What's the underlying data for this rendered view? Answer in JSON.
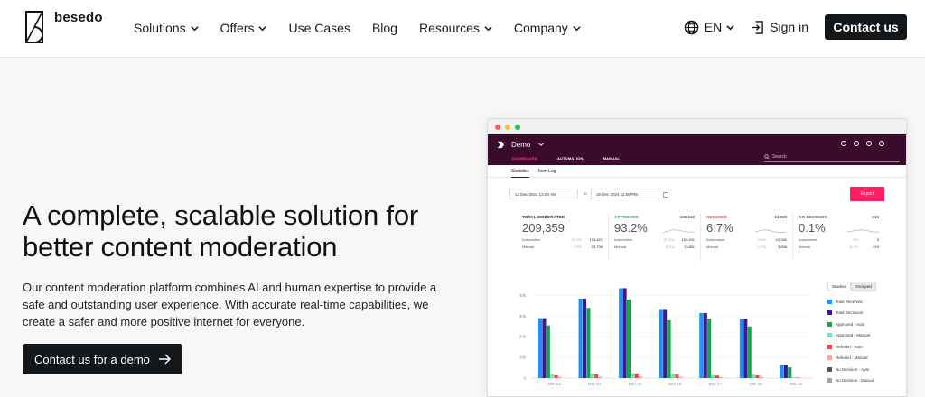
{
  "brand": {
    "name": "besedo"
  },
  "nav": {
    "items": [
      {
        "label": "Solutions",
        "has_menu": true
      },
      {
        "label": "Offers",
        "has_menu": true
      },
      {
        "label": "Use Cases",
        "has_menu": false
      },
      {
        "label": "Blog",
        "has_menu": false
      },
      {
        "label": "Resources",
        "has_menu": true
      },
      {
        "label": "Company",
        "has_menu": true
      }
    ],
    "language": "EN",
    "sign_in": "Sign in",
    "contact": "Contact us"
  },
  "hero": {
    "headline": "A complete, scalable solution for better content moderation",
    "body": "Our content moderation platform combines AI and human expertise to provide a safe and outstanding user experience. With accurate real-time capabilities, we create a safer and more positive internet for everyone.",
    "cta": "Contact us for a demo"
  },
  "mockup": {
    "app_title": "Demo",
    "tabs": [
      "DASHBOARD",
      "AUTOMATION",
      "MANUAL"
    ],
    "search_placeholder": "Search",
    "subtabs": [
      "Statistics",
      "Item Log"
    ],
    "date_from": "13 Dec 2024 12:00 AM",
    "date_to_label": "to",
    "date_to": "19 Dec 2024 11:59 PM",
    "export": "Export",
    "stats": [
      {
        "label": "TOTAL MODERATED",
        "total": "",
        "big": "209,359",
        "auto_pct": "92.5%",
        "auto": "193,621",
        "manual_pct": "7.5%",
        "manual": "15,738",
        "color": "#222222"
      },
      {
        "label": "APPROVED",
        "total": "195,152",
        "big": "93.2%",
        "auto_pct": "87.5%",
        "auto": "183,291",
        "manual_pct": "5.7%",
        "manual": "11,861",
        "color": "#16a34a"
      },
      {
        "label": "REFUSED",
        "total": "13,988",
        "big": "6.7%",
        "auto_pct": "4.9%",
        "auto": "10,330",
        "manual_pct": "1.7%",
        "manual": "3,658",
        "color": "#ef4444"
      },
      {
        "label": "NO DECISION",
        "total": "219",
        "big": "0.1%",
        "auto_pct": "0%",
        "auto": "0",
        "manual_pct": "0.1%",
        "manual": "219",
        "color": "#555555"
      }
    ],
    "row_labels": {
      "auto": "Automation",
      "manual": "Manual"
    },
    "toggle": [
      "Stacked",
      "Grouped"
    ]
  },
  "chart_data": {
    "type": "bar",
    "categories": [
      "Dec 13",
      "Dec 14",
      "Dec 15",
      "Dec 16",
      "Dec 17",
      "Dec 18",
      "Dec 19"
    ],
    "ytick_labels": [
      "0",
      "10k",
      "20k",
      "30k",
      "40k"
    ],
    "ylim": [
      0,
      45000
    ],
    "series": [
      {
        "name": "Total Received",
        "color": "#1e90ff",
        "values": [
          29000,
          38500,
          43500,
          33000,
          31500,
          28800,
          6200
        ]
      },
      {
        "name": "Total Decisions",
        "color": "#3b1a8f",
        "values": [
          29000,
          38500,
          43500,
          33000,
          31500,
          28800,
          6200
        ]
      },
      {
        "name": "Approved - Auto",
        "color": "#16a34a",
        "values": [
          25500,
          34000,
          38000,
          28000,
          28800,
          25000,
          5200
        ]
      },
      {
        "name": "Approved - Manual",
        "color": "#6ee7b7",
        "values": [
          1800,
          2200,
          2400,
          1900,
          1500,
          1700,
          300
        ]
      },
      {
        "name": "Refused - Auto",
        "color": "#ef4444",
        "values": [
          1300,
          1800,
          2100,
          1700,
          1200,
          1300,
          250
        ]
      },
      {
        "name": "Refused - Manual",
        "color": "#fca5a5",
        "values": [
          500,
          600,
          800,
          600,
          500,
          500,
          120
        ]
      },
      {
        "name": "No Decision - Auto",
        "color": "#555555",
        "values": [
          0,
          0,
          0,
          0,
          0,
          0,
          0
        ]
      },
      {
        "name": "No Decision - Manual",
        "color": "#9ca3af",
        "values": [
          30,
          40,
          40,
          30,
          30,
          30,
          10
        ]
      }
    ]
  }
}
